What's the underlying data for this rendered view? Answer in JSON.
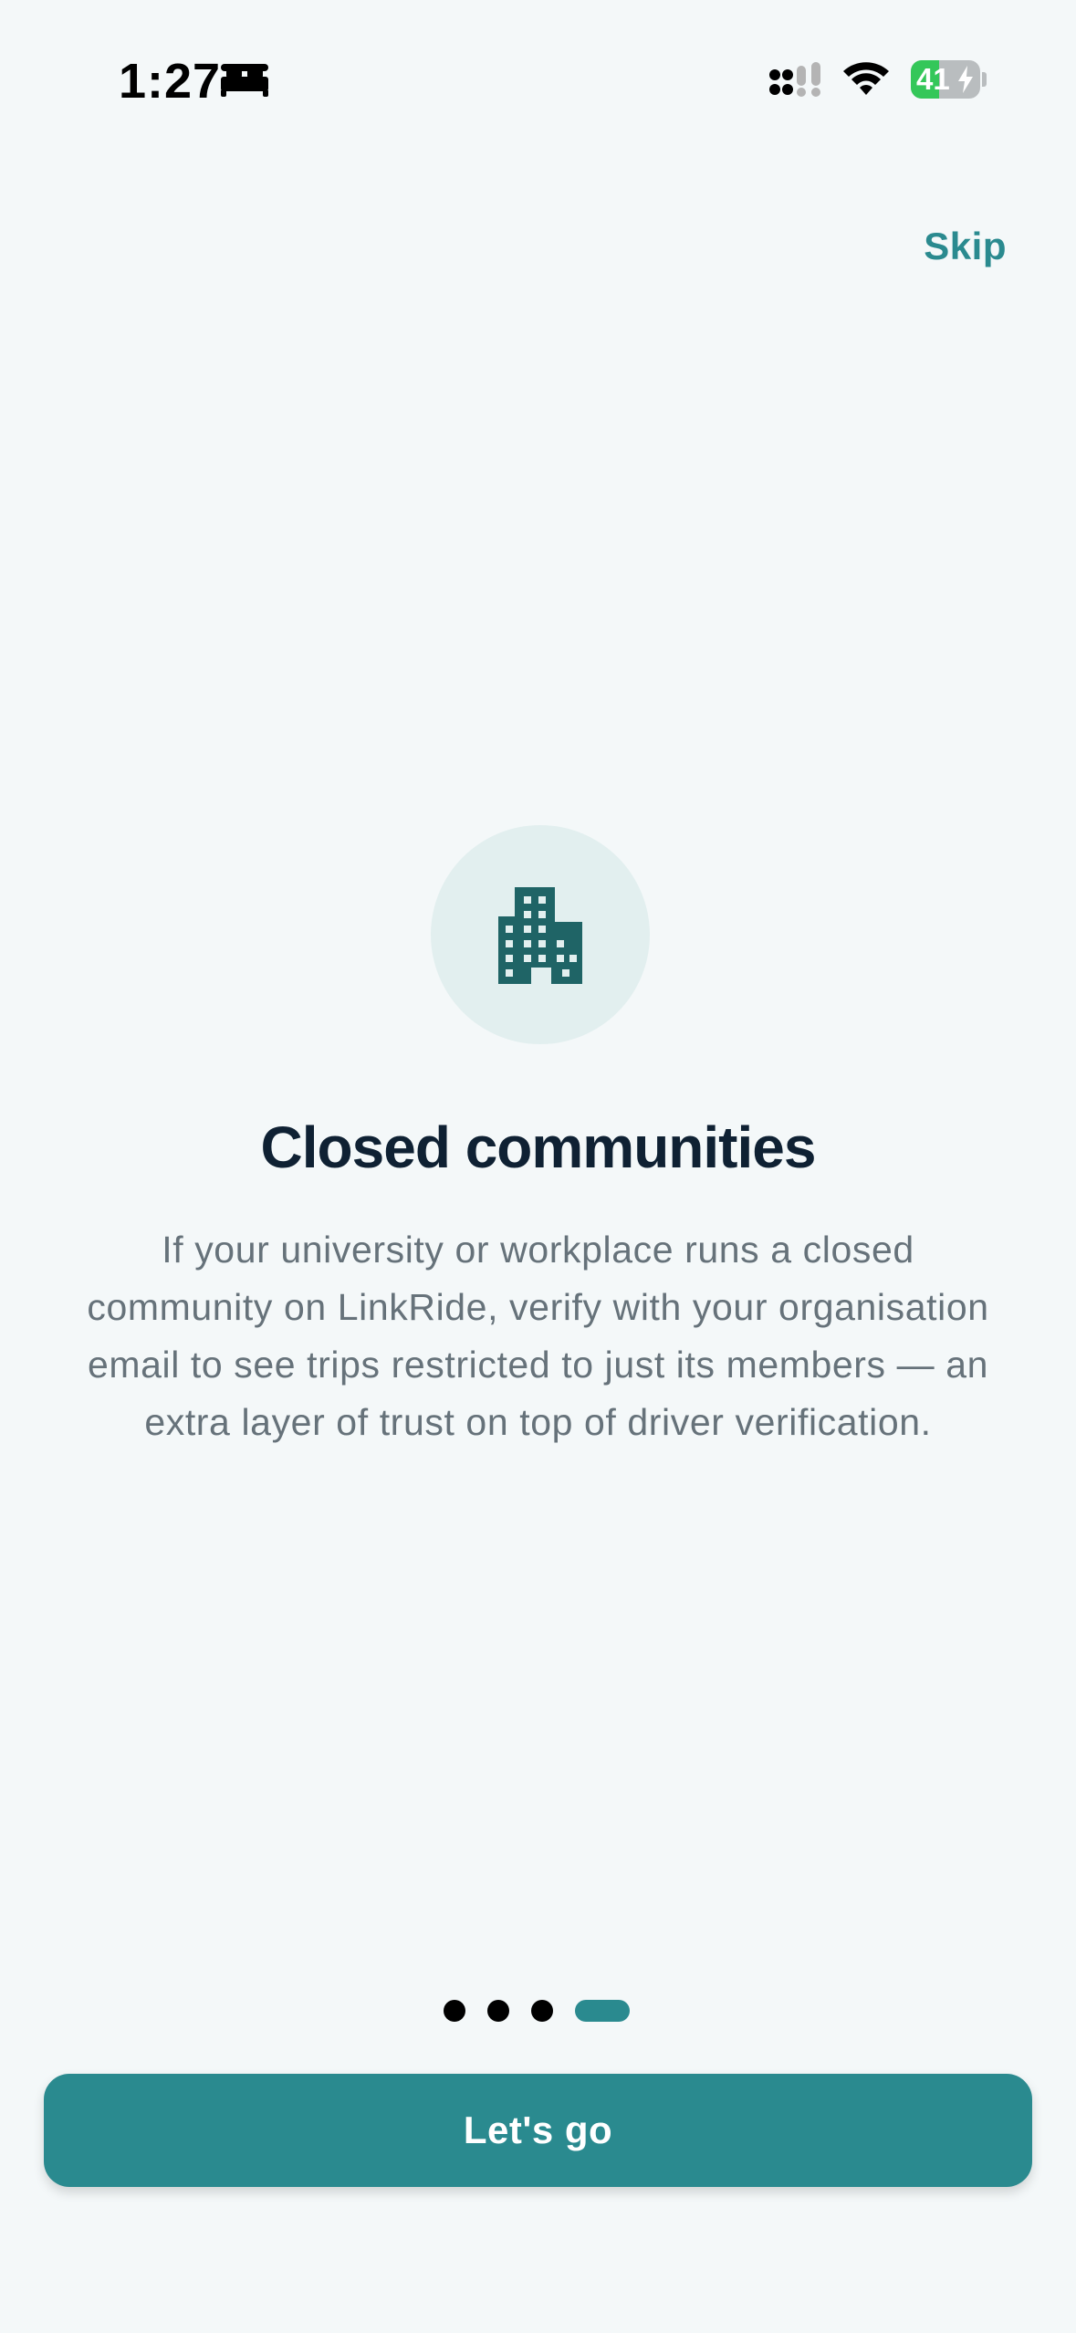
{
  "status_bar": {
    "time": "1:27",
    "battery_percent": "41",
    "battery_level": 0.41,
    "icons": [
      "bed-icon",
      "signal-icon",
      "wifi-icon",
      "battery-icon",
      "bolt-icon"
    ]
  },
  "header": {
    "skip_label": "Skip"
  },
  "slide": {
    "icon": "building-icon",
    "title": "Closed communities",
    "description": "If your university or workplace runs a closed community on LinkRide, verify with your organisation email to see trips restricted to just its members — an extra layer of trust on top of driver verification."
  },
  "pager": {
    "total": 4,
    "current": 4
  },
  "cta": {
    "label": "Let's go"
  },
  "colors": {
    "accent": "#2a8a8f",
    "background": "#f4f8f9",
    "title": "#0f2133",
    "body": "#66727a",
    "icon_circle": "#e2efef",
    "icon": "#1f6466",
    "battery_green": "#34c759"
  }
}
